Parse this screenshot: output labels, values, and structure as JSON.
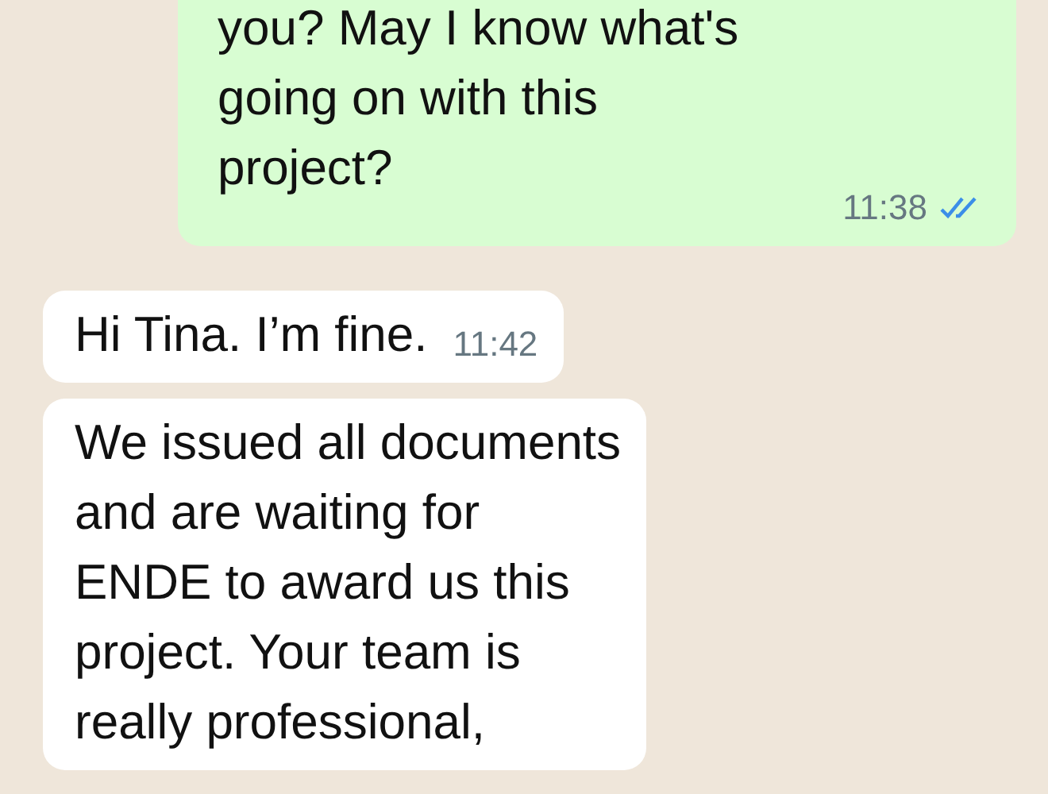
{
  "messages": [
    {
      "kind": "outgoing",
      "lines": [
        "you? May I know what's",
        "going on with this",
        "project?"
      ],
      "time": "11:38",
      "read": true
    },
    {
      "kind": "incoming",
      "lines": [
        "Hi Tina. I’m fine."
      ],
      "time": "11:42"
    },
    {
      "kind": "incoming",
      "lines": [
        "We issued all documents",
        "and are waiting for",
        "ENDE to award us this",
        "project. Your team is",
        "really professional,"
      ]
    }
  ]
}
